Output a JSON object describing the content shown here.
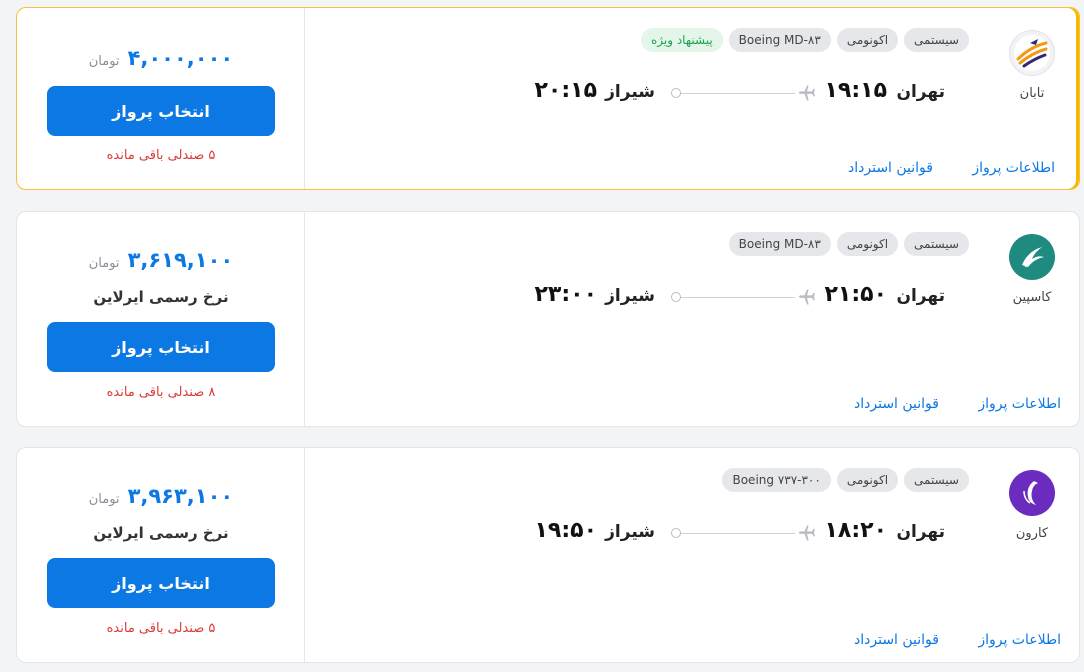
{
  "flights": [
    {
      "airline": "تابان",
      "logo_icon": "taban-logo-icon",
      "tags": [
        "سیستمی",
        "اکونومی",
        "Boeing MD-۸۳",
        "پیشنهاد ویژه"
      ],
      "origin_city": "تهران",
      "origin_time": "۱۹:۱۵",
      "dest_city": "شیراز",
      "dest_time": "۲۰:۱۵",
      "price": "۴,۰۰۰,۰۰۰",
      "currency": "تومان",
      "rate_note": "",
      "select_label": "انتخاب پرواز",
      "seats": "۵ صندلی باقی مانده",
      "info_link": "اطلاعات پرواز",
      "refund_link": "قوانین استرداد",
      "highlighted": true
    },
    {
      "airline": "کاسپین",
      "logo_icon": "caspian-logo-icon",
      "tags": [
        "سیستمی",
        "اکونومی",
        "Boeing MD-۸۳"
      ],
      "origin_city": "تهران",
      "origin_time": "۲۱:۵۰",
      "dest_city": "شیراز",
      "dest_time": "۲۳:۰۰",
      "price": "۳,۶۱۹,۱۰۰",
      "currency": "تومان",
      "rate_note": "نرخ رسمی ایرلاین",
      "select_label": "انتخاب پرواز",
      "seats": "۸ صندلی باقی مانده",
      "info_link": "اطلاعات پرواز",
      "refund_link": "قوانین استرداد",
      "highlighted": false
    },
    {
      "airline": "کارون",
      "logo_icon": "karun-logo-icon",
      "tags": [
        "سیستمی",
        "اکونومی",
        "Boeing ۷۳۷-۳۰۰"
      ],
      "origin_city": "تهران",
      "origin_time": "۱۸:۲۰",
      "dest_city": "شیراز",
      "dest_time": "۱۹:۵۰",
      "price": "۳,۹۶۳,۱۰۰",
      "currency": "تومان",
      "rate_note": "نرخ رسمی ایرلاین",
      "select_label": "انتخاب پرواز",
      "seats": "۵ صندلی باقی مانده",
      "info_link": "اطلاعات پرواز",
      "refund_link": "قوانین استرداد",
      "highlighted": false
    }
  ],
  "colors": {
    "primary": "#0b78e3",
    "seats_warning": "#d93a3a",
    "offer_tag_bg": "#e4f6ea",
    "offer_tag_text": "#21a150",
    "highlight_border": "#f6c13a"
  }
}
